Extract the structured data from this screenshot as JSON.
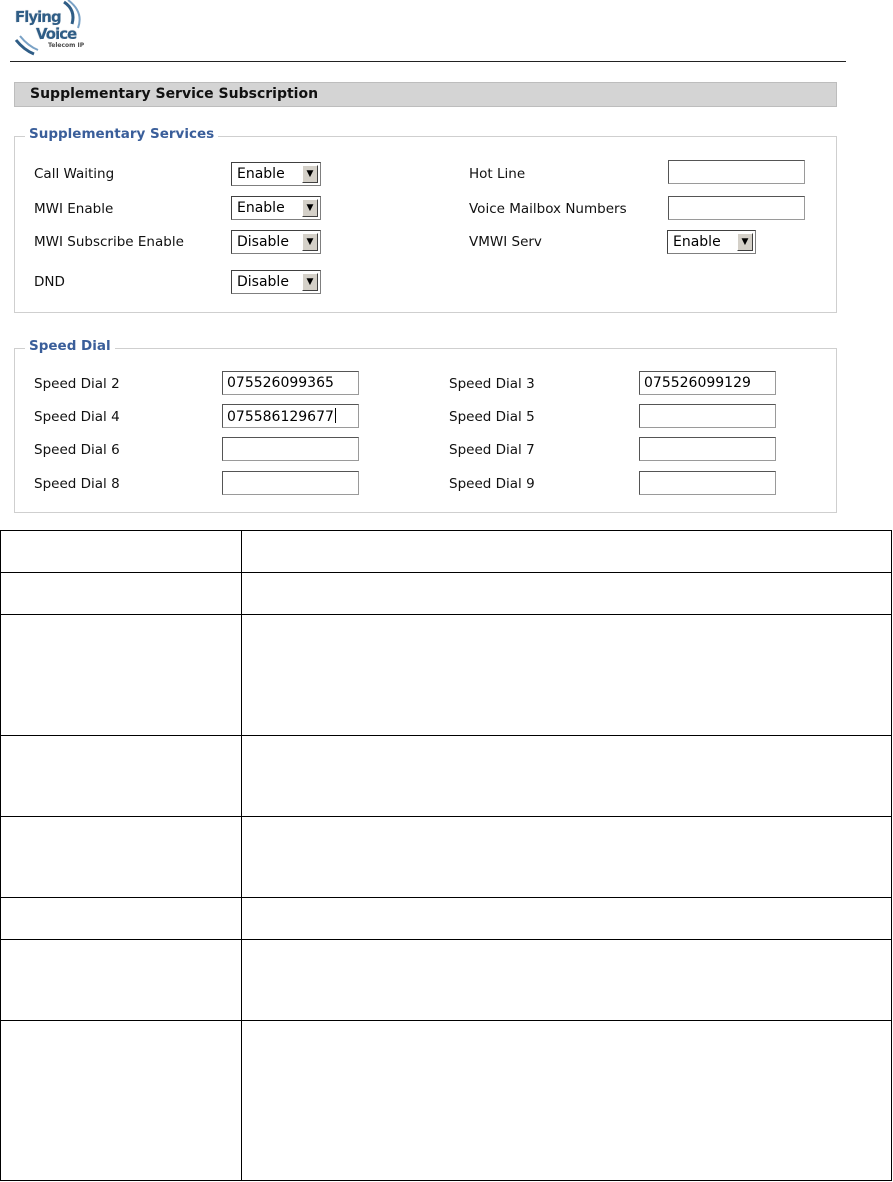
{
  "logo": {
    "line1": "Flying",
    "line2": "Voice",
    "tagline": "Telecom IP"
  },
  "section_title": "Supplementary Service Subscription",
  "supplementary_services": {
    "legend": "Supplementary Services",
    "call_waiting": {
      "label": "Call Waiting",
      "value": "Enable"
    },
    "mwi_enable": {
      "label": "MWI Enable",
      "value": "Enable"
    },
    "mwi_subscribe_enable": {
      "label": "MWI Subscribe Enable",
      "value": "Disable"
    },
    "dnd": {
      "label": "DND",
      "value": "Disable"
    },
    "hot_line": {
      "label": "Hot Line",
      "value": ""
    },
    "voice_mailbox_numbers": {
      "label": "Voice Mailbox Numbers",
      "value": ""
    },
    "vmwi_serv": {
      "label": "VMWI Serv",
      "value": "Enable"
    }
  },
  "speed_dial": {
    "legend": "Speed Dial",
    "sd2": {
      "label": "Speed Dial 2",
      "value": "075526099365"
    },
    "sd3": {
      "label": "Speed Dial 3",
      "value": "075526099129"
    },
    "sd4": {
      "label": "Speed Dial 4",
      "value": "075586129677"
    },
    "sd5": {
      "label": "Speed Dial 5",
      "value": ""
    },
    "sd6": {
      "label": "Speed Dial 6",
      "value": ""
    },
    "sd7": {
      "label": "Speed Dial 7",
      "value": ""
    },
    "sd8": {
      "label": "Speed Dial 8",
      "value": ""
    },
    "sd9": {
      "label": "Speed Dial 9",
      "value": ""
    }
  },
  "doc_table": {
    "rows": 8,
    "columns": 2
  },
  "colors": {
    "legend": "#3a5e9a",
    "section_bar": "#d4d4d4",
    "logo": "#2f5d86"
  },
  "icons": {
    "select_arrow": "triangle-down-icon"
  }
}
